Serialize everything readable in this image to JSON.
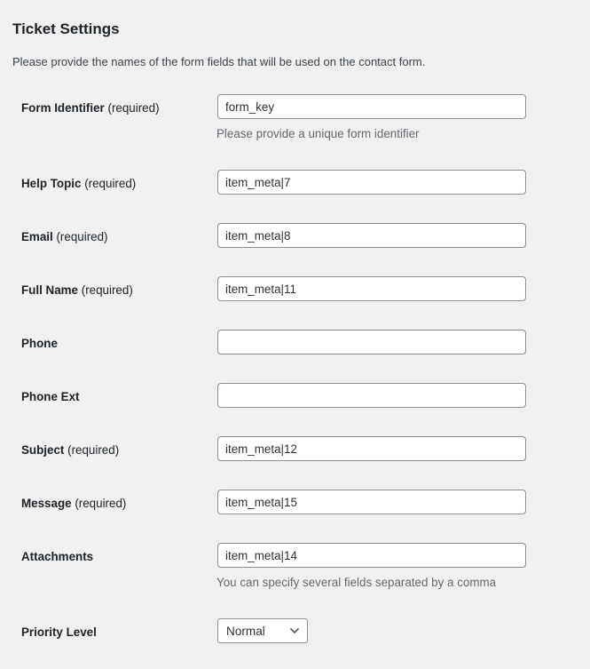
{
  "header": {
    "title": "Ticket Settings",
    "intro": "Please provide the names of the form fields that will be used on the contact form."
  },
  "fields": [
    {
      "label": "Form Identifier",
      "required_text": "(required)",
      "value": "form_key",
      "placeholder": "",
      "description": "Please provide a unique form identifier"
    },
    {
      "label": "Help Topic",
      "required_text": "(required)",
      "value": "item_meta|7",
      "placeholder": ""
    },
    {
      "label": "Email",
      "required_text": "(required)",
      "value": "item_meta|8",
      "placeholder": ""
    },
    {
      "label": "Full Name",
      "required_text": "(required)",
      "value": "item_meta|11",
      "placeholder": ""
    },
    {
      "label": "Phone",
      "required_text": "",
      "value": "",
      "placeholder": ""
    },
    {
      "label": "Phone Ext",
      "required_text": "",
      "value": "",
      "placeholder": ""
    },
    {
      "label": "Subject",
      "required_text": "(required)",
      "value": "item_meta|12",
      "placeholder": ""
    },
    {
      "label": "Message",
      "required_text": "(required)",
      "value": "item_meta|15",
      "placeholder": ""
    },
    {
      "label": "Attachments",
      "required_text": "",
      "value": "item_meta|14",
      "placeholder": "",
      "description": "You can specify several fields separated by a comma"
    }
  ],
  "priority": {
    "label": "Priority Level",
    "selected": "Normal",
    "icon": "chevron-down-icon"
  }
}
